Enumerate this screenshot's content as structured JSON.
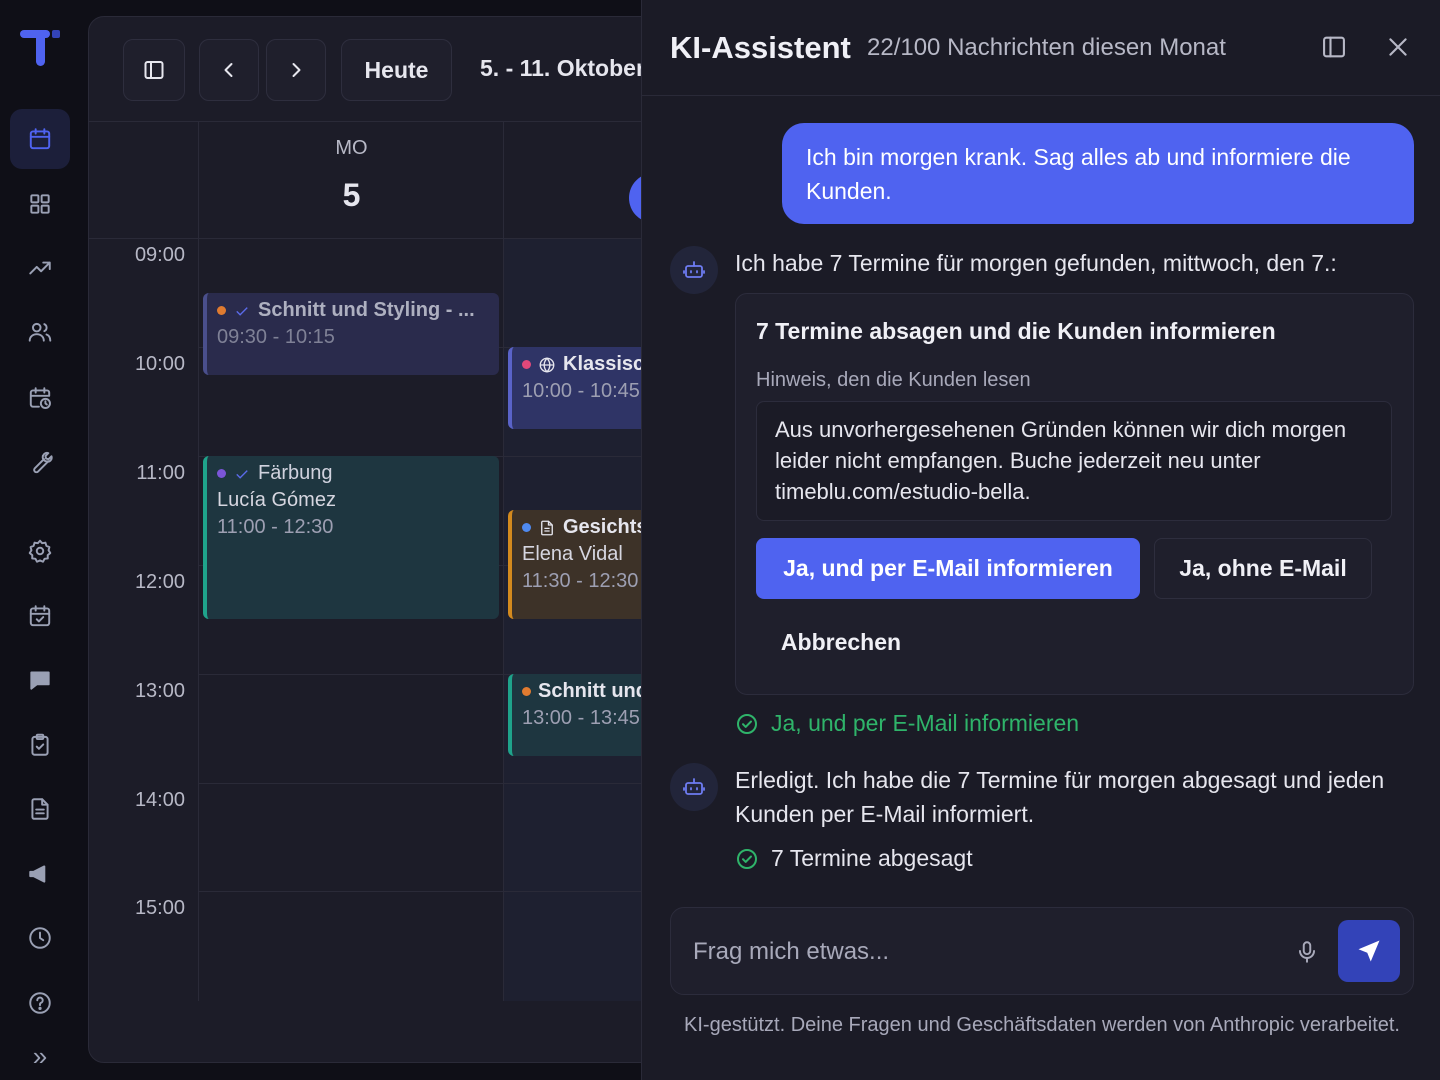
{
  "colors": {
    "accent": "#4f63f0",
    "success": "#2fb46a",
    "event_orange": "#e07b30",
    "event_purple": "#7b55d8",
    "event_pink": "#e0487a",
    "event_blue": "#4f63f0",
    "event_teal": "#1fa38b",
    "event_amber": "#d48a1e"
  },
  "rail": {
    "items": [
      {
        "icon": "calendar-icon"
      },
      {
        "icon": "dashboard-icon"
      },
      {
        "icon": "trending-icon"
      },
      {
        "icon": "users-icon"
      },
      {
        "icon": "calendar-clock-icon"
      },
      {
        "icon": "wrench-icon"
      },
      {
        "icon": "gear-icon"
      },
      {
        "icon": "calendar-check-icon"
      },
      {
        "icon": "chat-icon"
      },
      {
        "icon": "clipboard-check-icon"
      },
      {
        "icon": "document-icon"
      },
      {
        "icon": "megaphone-icon"
      },
      {
        "icon": "clock-icon"
      },
      {
        "icon": "help-icon"
      },
      {
        "icon": "expand-icon"
      }
    ],
    "expand_glyph": "»"
  },
  "calendar": {
    "today_label": "Heute",
    "range_label": "5. - 11. Oktober",
    "day_of_week": "MO",
    "day_number": "5",
    "times": [
      "09:00",
      "10:00",
      "11:00",
      "12:00",
      "13:00",
      "14:00",
      "15:00"
    ],
    "events": [
      {
        "title": "Schnitt und Styling - ...",
        "time": "09:30 - 10:15"
      },
      {
        "title": "Klassisch",
        "time": "10:00 - 10:45"
      },
      {
        "title": "Färbung",
        "client": "Lucía Gómez",
        "time": "11:00 - 12:30"
      },
      {
        "title": "Gesichts",
        "client": "Elena Vidal",
        "time": "11:30 - 12:30"
      },
      {
        "title": "Schnitt und",
        "time": "13:00 - 13:45"
      }
    ]
  },
  "assistant": {
    "title": "KI-Assistent",
    "usage": "22/100 Nachrichten diesen Monat",
    "user_message": "Ich bin morgen krank. Sag alles ab und informiere die Kunden.",
    "bot_message_1": "Ich habe 7 Termine für morgen gefunden, mittwoch, den 7.:",
    "card": {
      "title": "7 Termine absagen und die Kunden informieren",
      "note_label": "Hinweis, den die Kunden lesen",
      "note_text": "Aus unvorhergesehenen Gründen können wir dich morgen leider nicht empfangen. Buche jederzeit neu unter timeblu.com/estudio-bella.",
      "primary_button": "Ja, und per E-Mail informieren",
      "secondary_button": "Ja, ohne E-Mail",
      "cancel_button": "Abbrechen"
    },
    "selection_confirmation": "Ja, und per E-Mail informieren",
    "bot_message_2": "Erledigt. Ich habe die 7 Termine für morgen abgesagt und jeden Kunden per E-Mail informiert.",
    "result_status": "7 Termine abgesagt",
    "input_placeholder": "Frag mich etwas...",
    "footnote": "KI-gestützt. Deine Fragen und Geschäftsdaten werden von Anthropic verarbeitet."
  }
}
